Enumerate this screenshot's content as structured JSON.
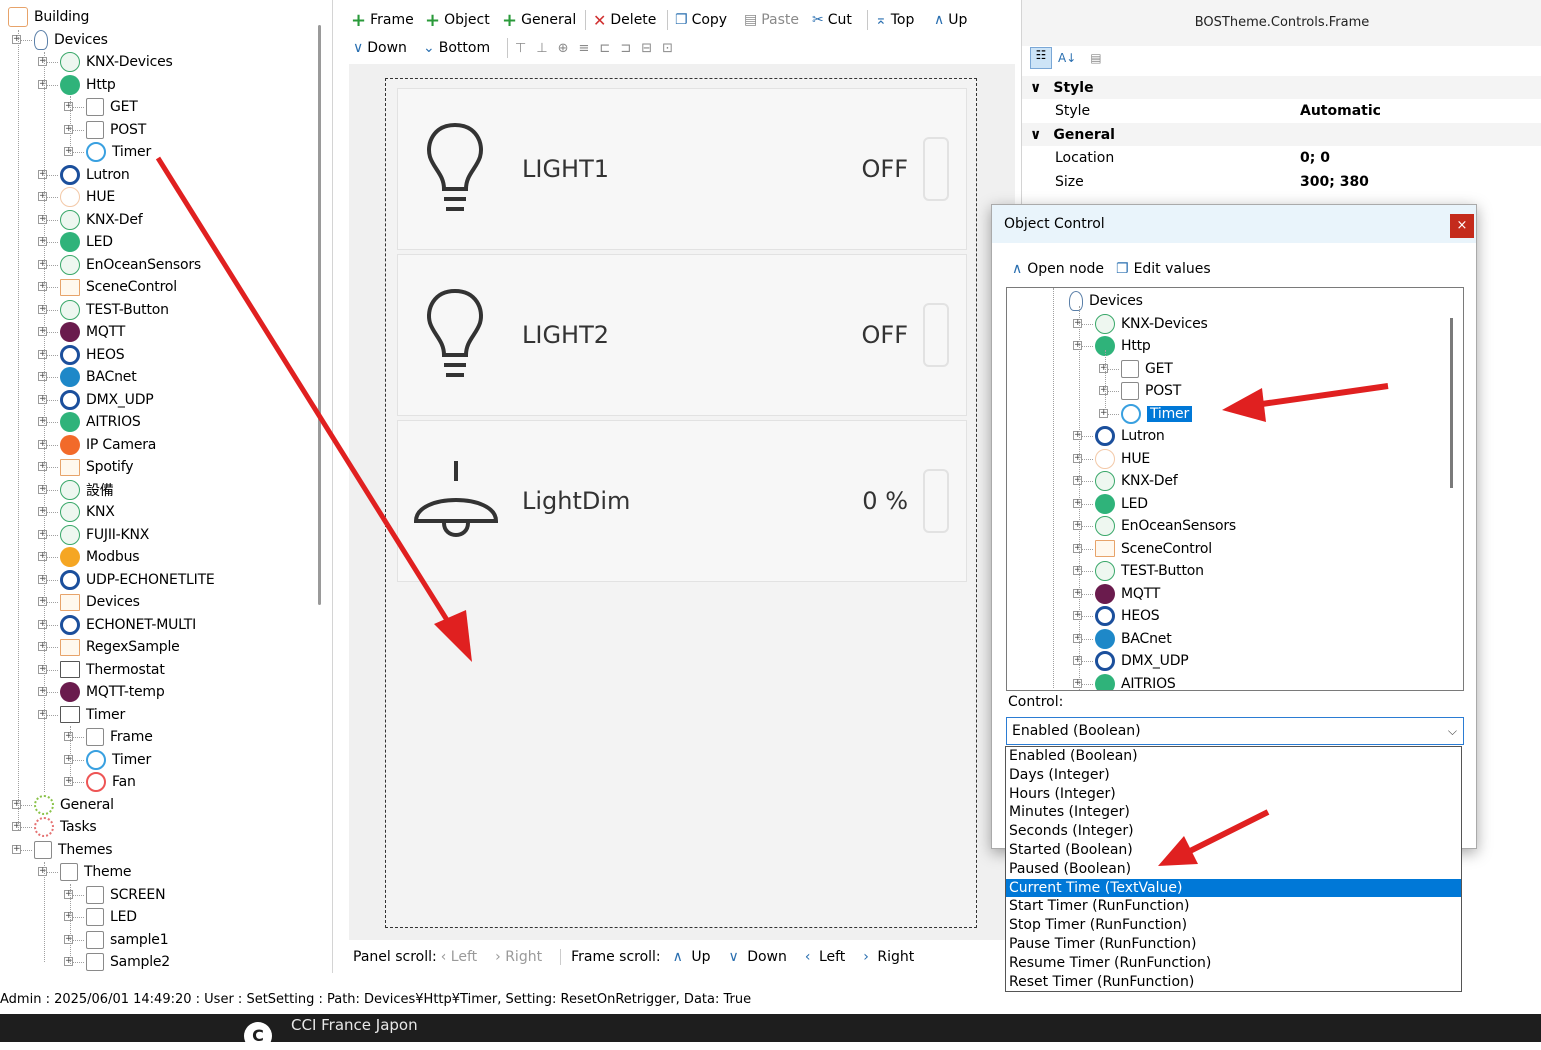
{
  "left_tree": [
    {
      "label": "Building",
      "indent": 0,
      "icon": "home-icon"
    },
    {
      "label": "Devices",
      "indent": 1,
      "icon": "bulb-icon"
    },
    {
      "label": "KNX-Devices",
      "indent": 2,
      "icon": "knx-icon"
    },
    {
      "label": "Http",
      "indent": 2,
      "icon": "http-icon"
    },
    {
      "label": "GET",
      "indent": 3,
      "icon": "function-icon"
    },
    {
      "label": "POST",
      "indent": 3,
      "icon": "function-icon"
    },
    {
      "label": "Timer",
      "indent": 3,
      "icon": "timer-icon"
    },
    {
      "label": "Lutron",
      "indent": 2,
      "icon": "cloud-icon"
    },
    {
      "label": "HUE",
      "indent": 2,
      "icon": "hue-icon"
    },
    {
      "label": "KNX-Def",
      "indent": 2,
      "icon": "knx-icon"
    },
    {
      "label": "LED",
      "indent": 2,
      "icon": "http-icon"
    },
    {
      "label": "EnOceanSensors",
      "indent": 2,
      "icon": "knx-icon"
    },
    {
      "label": "SceneControl",
      "indent": 2,
      "icon": "folder-icon"
    },
    {
      "label": "TEST-Button",
      "indent": 2,
      "icon": "knx-icon"
    },
    {
      "label": "MQTT",
      "indent": 2,
      "icon": "mqtt-icon"
    },
    {
      "label": "HEOS",
      "indent": 2,
      "icon": "cloud-icon"
    },
    {
      "label": "BACnet",
      "indent": 2,
      "icon": "bacnet-icon"
    },
    {
      "label": "DMX_UDP",
      "indent": 2,
      "icon": "cloud-icon"
    },
    {
      "label": "AITRIOS",
      "indent": 2,
      "icon": "http-icon"
    },
    {
      "label": "IP Camera",
      "indent": 2,
      "icon": "camera-icon"
    },
    {
      "label": "Spotify",
      "indent": 2,
      "icon": "folder-icon"
    },
    {
      "label": "設備",
      "indent": 2,
      "icon": "knx-icon"
    },
    {
      "label": "KNX",
      "indent": 2,
      "icon": "knx-icon"
    },
    {
      "label": "FUJII-KNX",
      "indent": 2,
      "icon": "knx-icon"
    },
    {
      "label": "Modbus",
      "indent": 2,
      "icon": "modbus-icon"
    },
    {
      "label": "UDP-ECHONETLITE",
      "indent": 2,
      "icon": "cloud-icon"
    },
    {
      "label": "Devices",
      "indent": 2,
      "icon": "folder-icon"
    },
    {
      "label": "ECHONET-MULTI",
      "indent": 2,
      "icon": "cloud-icon"
    },
    {
      "label": "RegexSample",
      "indent": 2,
      "icon": "folder-icon"
    },
    {
      "label": "Thermostat",
      "indent": 2,
      "icon": "folder-dark-icon"
    },
    {
      "label": "MQTT-temp",
      "indent": 2,
      "icon": "mqtt-icon"
    },
    {
      "label": "Timer",
      "indent": 2,
      "icon": "folder-dark-icon"
    },
    {
      "label": "Frame",
      "indent": 3,
      "icon": "frame-icon"
    },
    {
      "label": "Timer",
      "indent": 3,
      "icon": "timer-icon"
    },
    {
      "label": "Fan",
      "indent": 3,
      "icon": "power-icon"
    },
    {
      "label": "General",
      "indent": 1,
      "icon": "gear-icon"
    },
    {
      "label": "Tasks",
      "indent": 1,
      "icon": "tasks-icon"
    },
    {
      "label": "Themes",
      "indent": 1,
      "icon": "themes-icon"
    },
    {
      "label": "Theme",
      "indent": 2,
      "icon": "building-icon"
    },
    {
      "label": "SCREEN",
      "indent": 3,
      "icon": "screen-icon"
    },
    {
      "label": "LED",
      "indent": 3,
      "icon": "frame-icon"
    },
    {
      "label": "sample1",
      "indent": 3,
      "icon": "frame-icon"
    },
    {
      "label": "Sample2",
      "indent": 3,
      "icon": "frame-icon"
    }
  ],
  "toolbar": {
    "frame": "Frame",
    "object": "Object",
    "general": "General",
    "delete": "Delete",
    "copy": "Copy",
    "paste": "Paste",
    "cut": "Cut",
    "top": "Top",
    "up": "Up",
    "down": "Down",
    "bottom": "Bottom"
  },
  "cards": [
    {
      "name": "LIGHT1",
      "value": "OFF",
      "icon": "lightbulb-icon"
    },
    {
      "name": "LIGHT2",
      "value": "OFF",
      "icon": "lightbulb-icon"
    },
    {
      "name": "LightDim",
      "value": "0 %",
      "icon": "pendant-lamp-icon"
    }
  ],
  "bottom_bar": {
    "panel_scroll": "Panel scroll:",
    "left": "Left",
    "right": "Right",
    "frame_scroll": "Frame scroll:",
    "up": "Up",
    "down": "Down",
    "left2": "Left",
    "right2": "Right"
  },
  "properties": {
    "title": "BOSTheme.Controls.Frame",
    "style_cat": "Style",
    "style_name": "Style",
    "style_value": "Automatic",
    "general_cat": "General",
    "location_name": "Location",
    "location_value": "0; 0",
    "size_name": "Size",
    "size_value": "300; 380"
  },
  "dialog": {
    "title": "Object Control",
    "close": "×",
    "open_node": "Open node",
    "edit_values": "Edit values",
    "control_label": "Control:",
    "selected": "Enabled (Boolean)",
    "tree": [
      {
        "label": "Devices",
        "indent": 0,
        "icon": "bulb-icon"
      },
      {
        "label": "KNX-Devices",
        "indent": 1,
        "icon": "knx-icon"
      },
      {
        "label": "Http",
        "indent": 1,
        "icon": "http-icon"
      },
      {
        "label": "GET",
        "indent": 2,
        "icon": "function-icon"
      },
      {
        "label": "POST",
        "indent": 2,
        "icon": "function-icon"
      },
      {
        "label": "Timer",
        "indent": 2,
        "icon": "timer-icon",
        "selected": true
      },
      {
        "label": "Lutron",
        "indent": 1,
        "icon": "cloud-icon"
      },
      {
        "label": "HUE",
        "indent": 1,
        "icon": "hue-icon"
      },
      {
        "label": "KNX-Def",
        "indent": 1,
        "icon": "knx-icon"
      },
      {
        "label": "LED",
        "indent": 1,
        "icon": "http-icon"
      },
      {
        "label": "EnOceanSensors",
        "indent": 1,
        "icon": "knx-icon"
      },
      {
        "label": "SceneControl",
        "indent": 1,
        "icon": "folder-icon"
      },
      {
        "label": "TEST-Button",
        "indent": 1,
        "icon": "knx-icon"
      },
      {
        "label": "MQTT",
        "indent": 1,
        "icon": "mqtt-icon"
      },
      {
        "label": "HEOS",
        "indent": 1,
        "icon": "cloud-icon"
      },
      {
        "label": "BACnet",
        "indent": 1,
        "icon": "bacnet-icon"
      },
      {
        "label": "DMX_UDP",
        "indent": 1,
        "icon": "cloud-icon"
      },
      {
        "label": "AITRIOS",
        "indent": 1,
        "icon": "http-icon"
      }
    ],
    "options": [
      "Enabled (Boolean)",
      "Days (Integer)",
      "Hours (Integer)",
      "Minutes (Integer)",
      "Seconds (Integer)",
      "Started (Boolean)",
      "Paused (Boolean)",
      "Current Time (TextValue)",
      "Start Timer (RunFunction)",
      "Stop Timer (RunFunction)",
      "Pause Timer (RunFunction)",
      "Resume Timer (RunFunction)",
      "Reset Timer (RunFunction)"
    ],
    "highlighted_option": "Current Time (TextValue)"
  },
  "status": "Admin : 2025/06/01 14:49:20 : User : SetSetting : Path: Devices¥Http¥Timer, Setting: ResetOnRetrigger, Data: True",
  "footer": {
    "logo": "C",
    "text": "CCI France Japon"
  },
  "colors": {
    "arrow": "#e02020",
    "selection": "#0078d7",
    "knx": "#3aa86a",
    "cloud": "#1b4f9c",
    "mqtt": "#6a1b4d"
  }
}
